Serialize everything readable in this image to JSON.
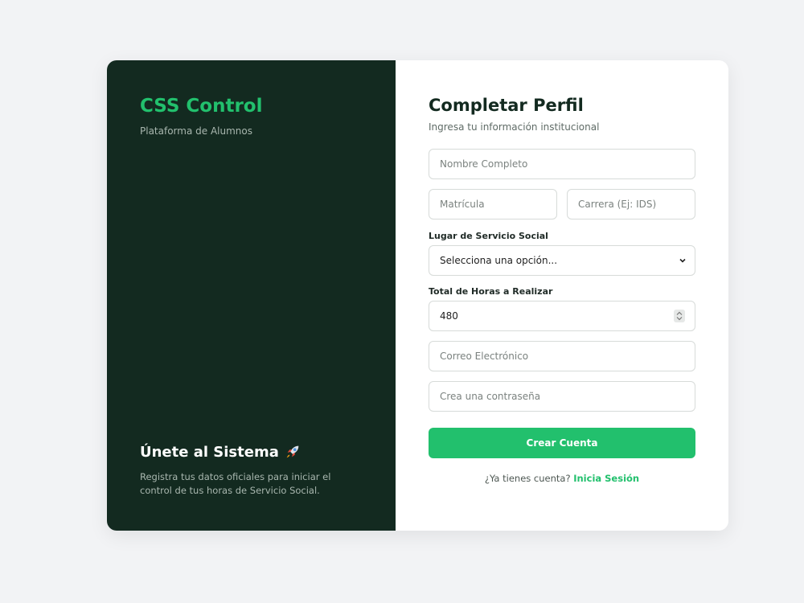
{
  "brand": {
    "title": "CSS Control",
    "subtitle": "Plataforma de Alumnos"
  },
  "promo": {
    "title": "Únete al Sistema",
    "icon": "rocket-icon",
    "description": "Registra tus datos oficiales para iniciar el control de tus horas de Servicio Social."
  },
  "form": {
    "title": "Completar Perfil",
    "subtitle": "Ingresa tu información institucional",
    "full_name": {
      "placeholder": "Nombre Completo",
      "value": ""
    },
    "enrollment": {
      "placeholder": "Matrícula",
      "value": ""
    },
    "career": {
      "placeholder": "Carrera (Ej: IDS)",
      "value": ""
    },
    "service_place": {
      "label": "Lugar de Servicio Social",
      "selected": "Selecciona una opción..."
    },
    "total_hours": {
      "label": "Total de Horas a Realizar",
      "value": "480"
    },
    "email": {
      "placeholder": "Correo Electrónico",
      "value": ""
    },
    "password": {
      "placeholder": "Crea una contraseña",
      "value": ""
    },
    "submit_label": "Crear Cuenta",
    "login_prompt": "¿Ya tienes cuenta?",
    "login_link": "Inicia Sesión"
  },
  "colors": {
    "accent": "#22c06d",
    "dark_panel": "#132a20",
    "background": "#f2f3f5"
  }
}
